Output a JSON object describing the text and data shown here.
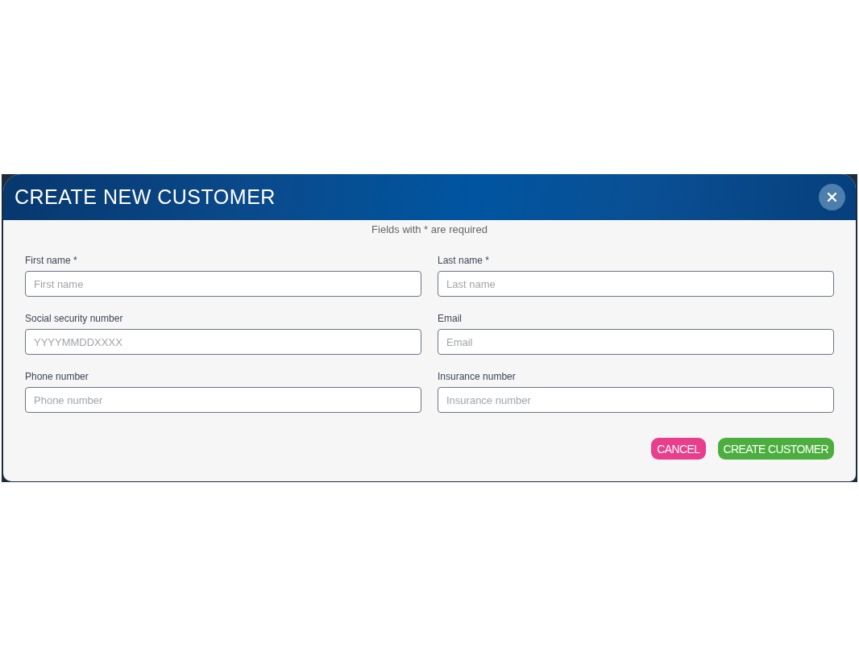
{
  "dialog": {
    "title": "CREATE NEW CUSTOMER",
    "note": "Fields with * are required",
    "fields": [
      {
        "label": "First name *",
        "placeholder": "First name"
      },
      {
        "label": "Last name *",
        "placeholder": "Last name"
      },
      {
        "label": "Social security number",
        "placeholder": "YYYYMMDDXXXX"
      },
      {
        "label": "Email",
        "placeholder": "Email"
      },
      {
        "label": "Phone number",
        "placeholder": "Phone number"
      },
      {
        "label": "Insurance number",
        "placeholder": "Insurance number"
      }
    ],
    "buttons": [
      {
        "label": "CANCEL",
        "kind": "cancel"
      },
      {
        "label": "CREATE CUSTOMER",
        "kind": "confirm"
      }
    ]
  }
}
